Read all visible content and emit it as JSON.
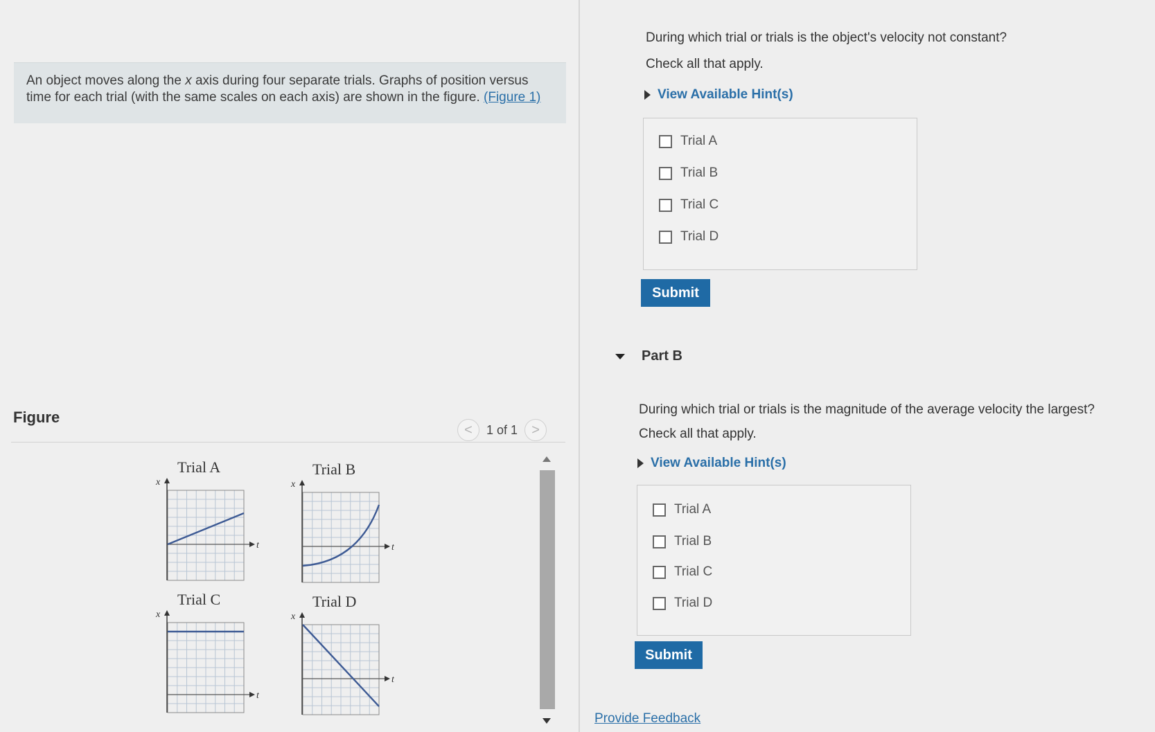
{
  "intro": {
    "text_before": "An object moves along the ",
    "axis_var": "x",
    "text_after": " axis during four separate trials. Graphs of position versus time for each trial (with the same scales on each axis) are shown in the figure. ",
    "figure_link": "(Figure 1)"
  },
  "figure": {
    "heading": "Figure",
    "pager_text": "1 of 1",
    "prev_glyph": "<",
    "next_glyph": ">",
    "x_axis_letter": "x",
    "t_axis_letter": "t",
    "trials": [
      {
        "label": "Trial A",
        "motion": "straight line rising"
      },
      {
        "label": "Trial B",
        "motion": "curve concave up"
      },
      {
        "label": "Trial C",
        "motion": "horizontal line"
      },
      {
        "label": "Trial D",
        "motion": "straight line falling"
      }
    ]
  },
  "part_a": {
    "question": "During which trial or trials is the object's velocity not constant?",
    "instruction": "Check all that apply.",
    "hint_label": "View Available Hint(s)",
    "choices": [
      "Trial A",
      "Trial B",
      "Trial C",
      "Trial D"
    ],
    "submit_label": "Submit"
  },
  "part_b": {
    "title": "Part B",
    "question": "During which trial or trials is the magnitude of the average velocity the largest?",
    "instruction": "Check all that apply.",
    "hint_label": "View Available Hint(s)",
    "choices": [
      "Trial A",
      "Trial B",
      "Trial C",
      "Trial D"
    ],
    "submit_label": "Submit"
  },
  "footer": {
    "feedback_label": "Provide Feedback"
  },
  "colors": {
    "accent": "#1f6aa5",
    "link": "#2a6fa8",
    "graph_line": "#3d5a94",
    "grid": "#b8c6d4"
  }
}
